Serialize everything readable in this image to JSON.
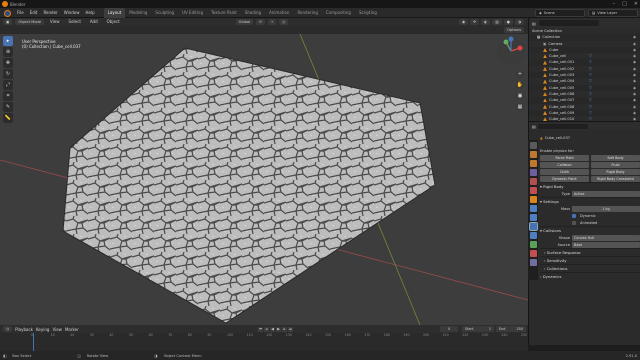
{
  "title_bar": {
    "title": "Blender"
  },
  "menu": [
    "File",
    "Edit",
    "Render",
    "Window",
    "Help"
  ],
  "workspaces": [
    "Layout",
    "Modeling",
    "Sculpting",
    "UV Editing",
    "Texture Paint",
    "Shading",
    "Animation",
    "Rendering",
    "Compositing",
    "Scripting"
  ],
  "active_workspace": "Layout",
  "top_right": {
    "scene": "Scene",
    "view_layer": "View Layer"
  },
  "viewport_header": {
    "mode": "Object Mode",
    "menus": [
      "View",
      "Select",
      "Add",
      "Object"
    ],
    "orientation": "Global",
    "options": "Options"
  },
  "viewport_overlay": {
    "line1": "User Perspective",
    "line2": "(0) Collection | Cube_cell.037"
  },
  "toolbar_icons": [
    "cursor-icon",
    "select-box-icon",
    "move-icon",
    "rotate-icon",
    "scale-icon",
    "transform-icon",
    "annotate-icon",
    "measure-icon"
  ],
  "outliner": {
    "header": "Scene Collection",
    "rows": [
      {
        "name": "Collection",
        "type": "collection"
      },
      {
        "name": "Camera",
        "type": "camera"
      },
      {
        "name": "Cube",
        "type": "mesh"
      },
      {
        "name": "Cube_cell",
        "type": "mesh"
      },
      {
        "name": "Cube_cell.001",
        "type": "mesh"
      },
      {
        "name": "Cube_cell.002",
        "type": "mesh"
      },
      {
        "name": "Cube_cell.003",
        "type": "mesh"
      },
      {
        "name": "Cube_cell.004",
        "type": "mesh"
      },
      {
        "name": "Cube_cell.005",
        "type": "mesh"
      },
      {
        "name": "Cube_cell.006",
        "type": "mesh"
      },
      {
        "name": "Cube_cell.007",
        "type": "mesh"
      },
      {
        "name": "Cube_cell.008",
        "type": "mesh"
      },
      {
        "name": "Cube_cell.009",
        "type": "mesh"
      },
      {
        "name": "Cube_cell.010",
        "type": "mesh"
      }
    ]
  },
  "properties": {
    "object_name": "Cube_cell.037",
    "panel_title": "Enable physics for:",
    "physics_buttons": [
      [
        "Force Field",
        "Soft Body"
      ],
      [
        "Collision",
        "Fluid"
      ],
      [
        "Cloth",
        "Rigid Body"
      ],
      [
        "Dynamic Paint",
        "Rigid Body Constraint"
      ]
    ],
    "rigid_body": "Rigid Body",
    "type_label": "Type",
    "type_value": "Active",
    "settings": "Settings",
    "mass_label": "Mass",
    "mass_value": "1 kg",
    "dynamic": "Dynamic",
    "animated": "Animated",
    "collisions": "Collisions",
    "shape_label": "Shape",
    "shape_value": "Convex Hull",
    "source_label": "Source",
    "source_value": "Base",
    "surface_response": "Surface Response",
    "sensitivity": "Sensitivity",
    "collections": "Collections",
    "dynamics": "Dynamics"
  },
  "timeline": {
    "menus": [
      "Playback",
      "Keying",
      "View",
      "Marker"
    ],
    "current_frame": "0",
    "start_label": "Start",
    "start": "1",
    "end_label": "End",
    "end": "250",
    "ticks": [
      "0",
      "10",
      "20",
      "30",
      "40",
      "50",
      "60",
      "70",
      "80",
      "90",
      "100",
      "110",
      "120",
      "130",
      "140",
      "150",
      "160",
      "170",
      "180",
      "190",
      "200",
      "210",
      "220",
      "230",
      "240",
      "250"
    ]
  },
  "status_bar": {
    "select": "Box Select",
    "rotate": "Rotate View",
    "menu": "Object Context Menu",
    "version": "2.91.0"
  },
  "colors": {
    "accent": "#4772b3",
    "orange": "#e87d0d",
    "viewport": "#3d3d3d",
    "stone": "#c8c8c8"
  }
}
